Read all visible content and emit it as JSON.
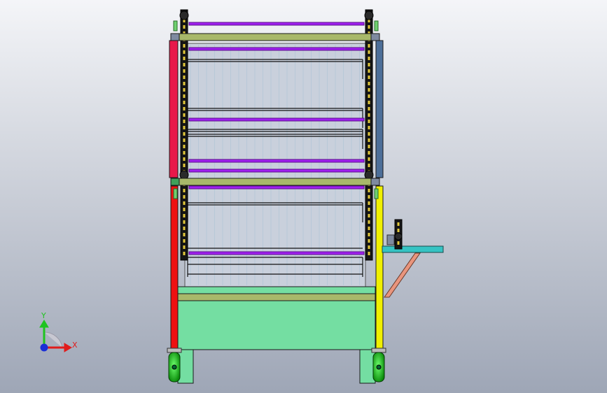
{
  "viewport": {
    "background_top": "#f4f5f8",
    "background_bottom": "#9ea6b6"
  },
  "model": {
    "frame_colors": {
      "left_post_upper": "#e8194a",
      "left_post_lower": "#ee1111",
      "right_post_upper": "#4d6f99",
      "right_post_lower": "#f0f000",
      "crossbar": "#a8b86a",
      "base": "#74dea2",
      "bracket": "#36c3c3",
      "brace": "#e9957d",
      "rod": "#a020f0",
      "chain": "#151515",
      "chain_link": "#e2c83a",
      "wheel": "#10d010",
      "wire": "#b8c8d8"
    }
  },
  "triad": {
    "y_label": "Y",
    "x_label": "X",
    "y_color": "#1fc41f",
    "x_color": "#e01c1c",
    "z_color": "#1a2fd6"
  }
}
